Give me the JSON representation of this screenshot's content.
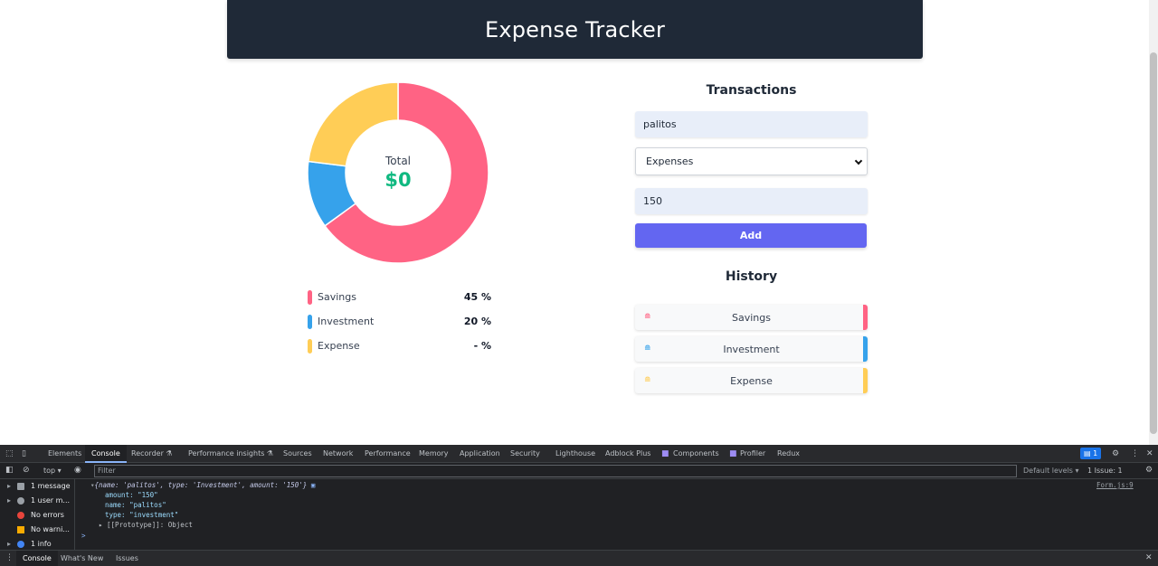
{
  "app": {
    "title": "Expense Tracker"
  },
  "chart": {
    "center_label": "Total",
    "center_value": "$0",
    "colors": {
      "savings": "#ff6384",
      "investment": "#36a2eb",
      "expense": "#ffcd56"
    }
  },
  "chart_data": {
    "type": "pie",
    "categories": [
      "Savings",
      "Investment",
      "Expense"
    ],
    "values": [
      65,
      12,
      23
    ],
    "colors": [
      "#ff6384",
      "#36a2eb",
      "#ffcd56"
    ]
  },
  "legend": [
    {
      "name": "Savings",
      "value": "45 %",
      "color": "#ff6384"
    },
    {
      "name": "Investment",
      "value": "20 %",
      "color": "#36a2eb"
    },
    {
      "name": "Expense",
      "value": "- %",
      "color": "#ffcd56"
    }
  ],
  "form": {
    "title": "Transactions",
    "name_value": "palitos",
    "type_value": "Expenses",
    "amount_value": "150",
    "add_label": "Add"
  },
  "history": {
    "title": "History",
    "icon": "trash-icon",
    "items": [
      {
        "name": "Savings",
        "color": "#ff6384"
      },
      {
        "name": "Investment",
        "color": "#36a2eb"
      },
      {
        "name": "Expense",
        "color": "#ffcd56"
      }
    ]
  },
  "devtools": {
    "tabs": [
      "Elements",
      "Console",
      "Recorder ⚗",
      "Performance insights ⚗",
      "Sources",
      "Network",
      "Performance",
      "Memory",
      "Application",
      "Security",
      "Lighthouse",
      "Adblock Plus",
      "Components",
      "Profiler",
      "Redux"
    ],
    "badge_count": "1",
    "context": "top",
    "filter_placeholder": "Filter",
    "default_levels": "Default levels",
    "issues": "1 Issue: 1",
    "sidebar": [
      "1 message",
      "1 user m...",
      "No errors",
      "No warni...",
      "1 info"
    ],
    "console_lines": {
      "object": "{name: 'palitos', type: 'Investment', amount: '150'}",
      "amount": "amount: \"150\"",
      "name": "name: \"palitos\"",
      "type": "type: \"investment\"",
      "proto": "[[Prototype]]: Object",
      "source": "Form.js:9",
      "prompt": ">"
    },
    "bottom_tabs": [
      "Console",
      "What's New",
      "Issues"
    ]
  }
}
